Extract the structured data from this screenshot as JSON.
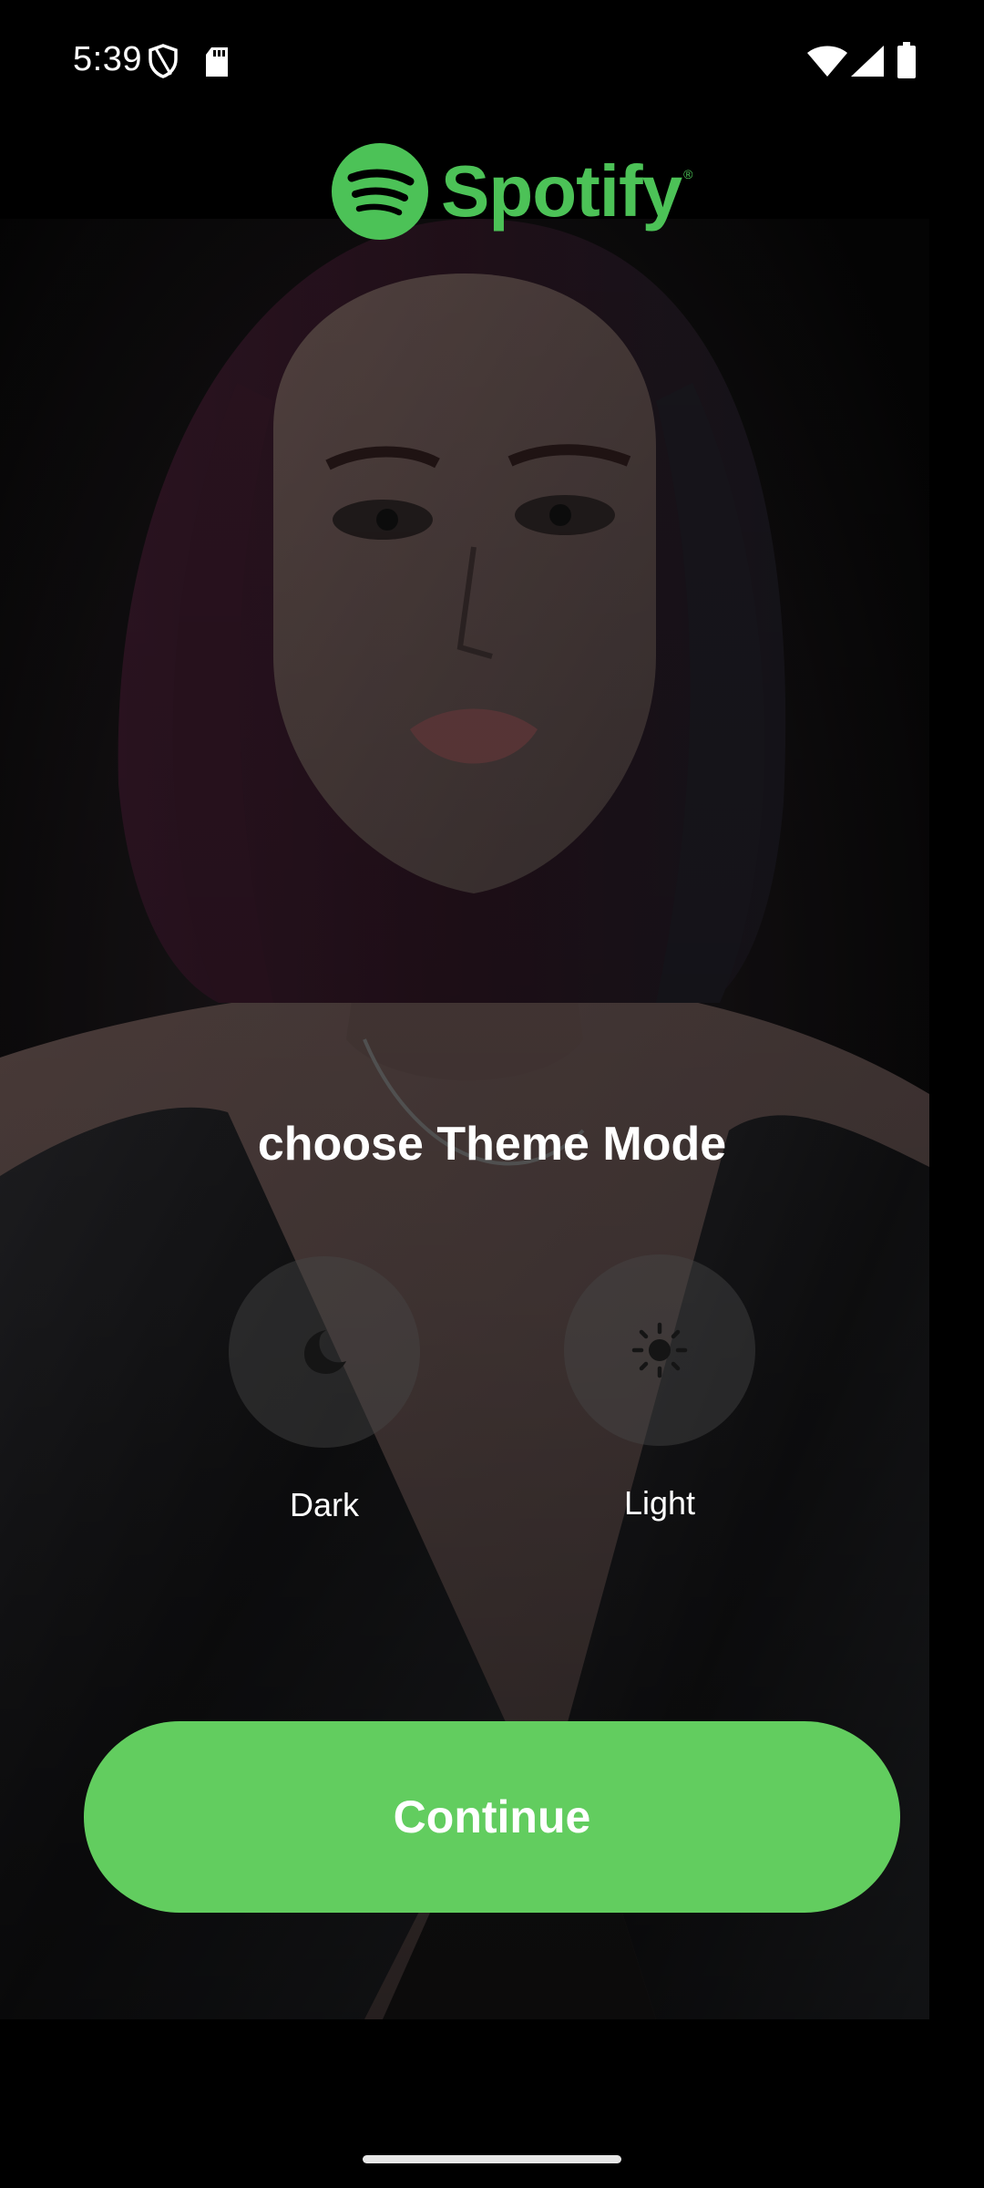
{
  "status_bar": {
    "time": "5:39",
    "icons": [
      "shield-icon",
      "sd-card-icon",
      "wifi-icon",
      "signal-icon",
      "battery-icon"
    ]
  },
  "brand": {
    "name": "Spotify",
    "registered_mark": "®",
    "color": "#4cc257"
  },
  "heading": "choose Theme Mode",
  "theme_options": [
    {
      "label": "Dark",
      "icon": "moon-icon"
    },
    {
      "label": "Light",
      "icon": "sun-icon"
    }
  ],
  "continue_button": {
    "label": "Continue",
    "color": "#62cd5f"
  },
  "colors": {
    "background": "#000000",
    "text": "#ffffff"
  }
}
